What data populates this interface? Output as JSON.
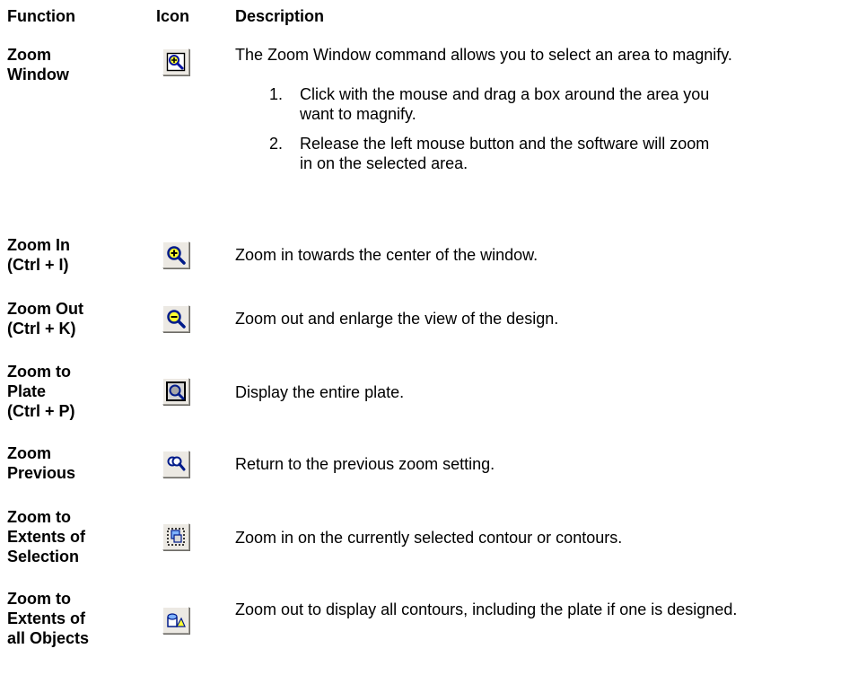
{
  "headers": {
    "function": "Function",
    "icon": "Icon",
    "description": "Description"
  },
  "rows": [
    {
      "function": "Zoom\nWindow",
      "icon": "zoom-window-icon",
      "description": "The Zoom Window command allows you to select an area to magnify.",
      "steps": [
        {
          "num": "1.",
          "text": "Click with the mouse and drag a box around the area you want to magnify."
        },
        {
          "num": "2.",
          "text": "Release the left mouse button and the software will zoom in on the selected area."
        }
      ]
    },
    {
      "function": "Zoom In\n(Ctrl + I)",
      "icon": "zoom-in-icon",
      "description": "Zoom in towards the center of the window."
    },
    {
      "function": "Zoom Out\n(Ctrl + K)",
      "icon": "zoom-out-icon",
      "description": "Zoom out and enlarge the view of the design."
    },
    {
      "function": "Zoom to\nPlate\n(Ctrl + P)",
      "icon": "zoom-to-plate-icon",
      "description": "Display the entire plate."
    },
    {
      "function": "Zoom\nPrevious",
      "icon": "zoom-previous-icon",
      "description": "Return to the previous zoom setting."
    },
    {
      "function": "Zoom to\nExtents of\nSelection",
      "icon": "zoom-extents-selection-icon",
      "description": "Zoom in on the currently selected contour or contours."
    },
    {
      "function": "Zoom to\nExtents of\nall Objects",
      "icon": "zoom-extents-all-icon",
      "description": "Zoom out to display all contours, including the plate if one is designed."
    }
  ]
}
